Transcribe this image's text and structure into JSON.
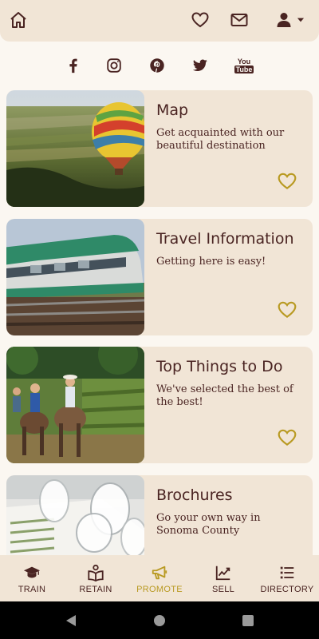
{
  "header": {
    "home_icon": "home-icon",
    "favorites_icon": "heart-icon",
    "mail_icon": "mail-icon",
    "account_icon": "user-icon"
  },
  "social": [
    "facebook-icon",
    "instagram-icon",
    "pinterest-icon",
    "twitter-icon",
    "youtube-icon"
  ],
  "social_labels": {
    "youtube_top": "You",
    "youtube_bottom": "Tube"
  },
  "cards": [
    {
      "title": "Map",
      "description": "Get acquainted with our beautiful destination",
      "image": "vineyard-hot-air-balloon-photo"
    },
    {
      "title": "Travel Information",
      "description": "Getting here is easy!",
      "image": "green-commuter-train-photo"
    },
    {
      "title": "Top Things to Do",
      "description": "We've selected the best of the best!",
      "image": "horseback-riding-vineyard-photo"
    },
    {
      "title": "Brochures",
      "description": "Go your own way in Sonoma County",
      "image": "wine-glasses-tasting-sheet-photo"
    }
  ],
  "nav": [
    {
      "label": "TRAIN",
      "icon": "graduation-cap-icon",
      "active": false
    },
    {
      "label": "RETAIN",
      "icon": "book-reader-icon",
      "active": false
    },
    {
      "label": "PROMOTE",
      "icon": "megaphone-icon",
      "active": true
    },
    {
      "label": "SELL",
      "icon": "line-chart-icon",
      "active": false
    },
    {
      "label": "DIRECTORY",
      "icon": "list-icon",
      "active": false
    }
  ],
  "colors": {
    "brand_dark": "#4a2422",
    "accent_gold": "#b99a22",
    "card_bg": "#f1e5d6",
    "page_bg": "#fbf7f1"
  }
}
